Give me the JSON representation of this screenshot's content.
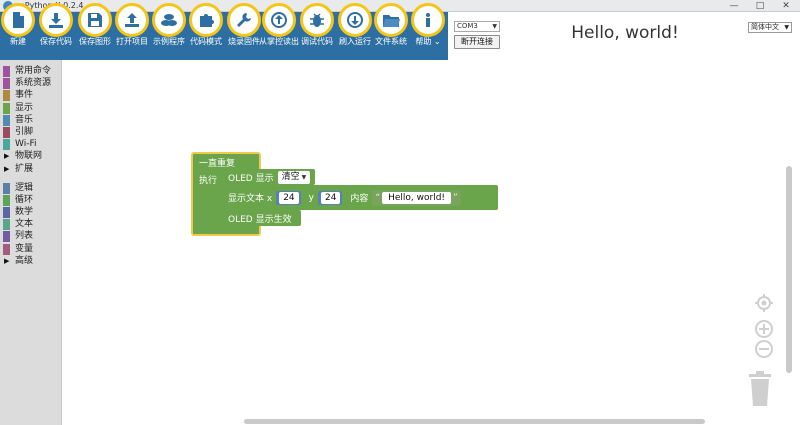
{
  "window": {
    "title": "mPython X 0.2.4",
    "minimize": "—",
    "maximize": "□",
    "close": "✕"
  },
  "toolbar": {
    "items": [
      {
        "label": "新建",
        "icon": "new-file-icon"
      },
      {
        "label": "保存代码",
        "icon": "download-icon"
      },
      {
        "label": "保存图形",
        "icon": "save-icon"
      },
      {
        "label": "打开项目",
        "icon": "upload-icon"
      },
      {
        "label": "示例程序",
        "icon": "coins-icon"
      },
      {
        "label": "代码模式",
        "icon": "puzzle-icon"
      },
      {
        "label": "烧录固件",
        "icon": "wrench-icon"
      },
      {
        "label": "从掌控读出",
        "icon": "arrow-up-circle-icon"
      },
      {
        "label": "调试代码",
        "icon": "bug-icon"
      },
      {
        "label": "刷入运行",
        "icon": "arrow-down-circle-icon"
      },
      {
        "label": "文件系统",
        "icon": "folder-icon"
      },
      {
        "label": "帮助 ⌄",
        "icon": "info-icon"
      }
    ]
  },
  "connection": {
    "port": "COM3",
    "disconnect_label": "断开连接"
  },
  "display_preview": "Hello, world!",
  "language": {
    "selected": "简体中文"
  },
  "categories": {
    "group1": [
      {
        "label": "常用命令",
        "color": "#a0529f"
      },
      {
        "label": "系统资源",
        "color": "#a0529f"
      },
      {
        "label": "事件",
        "color": "#b08a3e"
      },
      {
        "label": "显示",
        "color": "#6aa54b"
      },
      {
        "label": "音乐",
        "color": "#4f8bb5"
      },
      {
        "label": "引脚",
        "color": "#9b4a62"
      },
      {
        "label": "Wi-Fi",
        "color": "#4aa89a"
      }
    ],
    "group2": [
      {
        "label": "物联网"
      },
      {
        "label": "扩展"
      }
    ],
    "group3": [
      {
        "label": "逻辑",
        "color": "#5b80a5"
      },
      {
        "label": "循环",
        "color": "#5ba55b"
      },
      {
        "label": "数学",
        "color": "#5b67a5"
      },
      {
        "label": "文本",
        "color": "#5ba58c"
      },
      {
        "label": "列表",
        "color": "#745ba5"
      },
      {
        "label": "变量",
        "color": "#a55b80"
      }
    ],
    "group4": [
      {
        "label": "高级"
      }
    ]
  },
  "blocks": {
    "forever": "一直重复",
    "do": "执行",
    "oled_fill": {
      "label": "OLED 显示",
      "option": "清空"
    },
    "show_text": {
      "label": "显示文本 x",
      "x": "24",
      "y_label": "y",
      "y": "24",
      "content_label": "内容",
      "open_quote": "“",
      "text": "Hello, world!",
      "close_quote": "”"
    },
    "oled_show": "OLED 显示生效"
  },
  "colors": {
    "toolbar": "#2d6fa2",
    "ring": "#f5c518",
    "block_green": "#6aa54b",
    "math_blue": "#5b7fb7",
    "text_green": "#7aa35d",
    "hat_border": "#f2c94c"
  }
}
